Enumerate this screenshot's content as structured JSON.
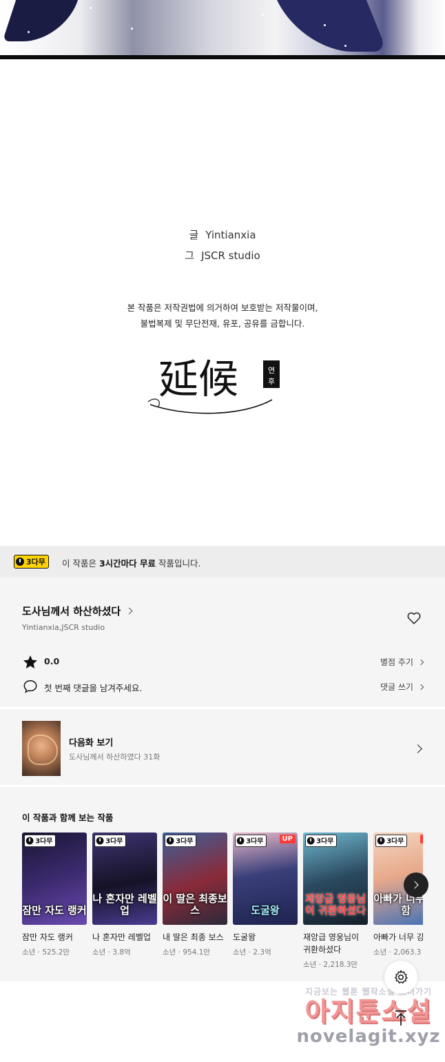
{
  "credits": {
    "writer_label": "글",
    "writer": "Yintianxia",
    "artist_label": "그",
    "artist": "JSCR studio"
  },
  "copyright_notice": [
    "본 작품은 저작권법에 의거하여 보호받는 저작물이며,",
    "불법복제 및 무단전재, 유포, 공유를 금합니다."
  ],
  "logo": {
    "text": "延候",
    "subtitle": "연후"
  },
  "free_banner": {
    "badge": "3다무",
    "text_prefix": "이 작품은 ",
    "text_bold": "3시간마다 무료",
    "text_suffix": " 작품입니다."
  },
  "work": {
    "title": "도사님께서 하산하셨다",
    "authors": "Yintianxia,JSCR studio",
    "rating": "0.0",
    "rate_link": "별점 주기",
    "comment_prompt": "첫 번째 댓글을 남겨주세요.",
    "comment_link": "댓글 쓰기"
  },
  "next_episode": {
    "label": "다음화 보기",
    "subtitle": "도사님께서 하산하였다 31화"
  },
  "recommendations": {
    "heading": "이 작품과 함께 보는 작품",
    "items": [
      {
        "name": "잠만 자도 랭커",
        "meta": "소년 · 525.2만",
        "cover_text": "잠만 자도 랭커",
        "badge": "3다무",
        "up": "",
        "colors": [
          "#2b2150",
          "#5a3b8a"
        ]
      },
      {
        "name": "나 혼자만 레벨업",
        "meta": "소년 · 3.8억",
        "cover_text": "나 혼자만 레벨업",
        "badge": "3다무",
        "up": "",
        "colors": [
          "#1d1a3a",
          "#6a55b5"
        ]
      },
      {
        "name": "내 딸은 최종 보스",
        "meta": "소년 · 954.1만",
        "cover_text": "이 딸은 최종보스",
        "badge": "3다무",
        "up": "",
        "colors": [
          "#6d2030",
          "#3a5fa0"
        ]
      },
      {
        "name": "도굴왕",
        "meta": "소년 · 2.3억",
        "cover_text": "도굴왕",
        "badge": "3다무",
        "up": "UP",
        "colors": [
          "#26305e",
          "#c76b8a"
        ]
      },
      {
        "name": "재앙급 영웅님이 귀환하셨다",
        "meta": "소년 · 2,218.3만",
        "cover_text": "재앙급 영웅님이 귀환하셨다",
        "badge": "3다무",
        "up": "",
        "colors": [
          "#2a4a5a",
          "#7fd0e0"
        ]
      },
      {
        "name": "아빠가 너무 강",
        "meta": "소년 · 2,063.3",
        "cover_text": "아빠가 너무 강함",
        "badge": "3다무",
        "up": "UP",
        "colors": [
          "#f1c4a6",
          "#4a78c0"
        ]
      }
    ]
  },
  "watermark": {
    "line1": "지금보는 웹툰 웹작소설 보러가기",
    "line2": "아지툰소설",
    "line3": "novelagit.xyz"
  }
}
